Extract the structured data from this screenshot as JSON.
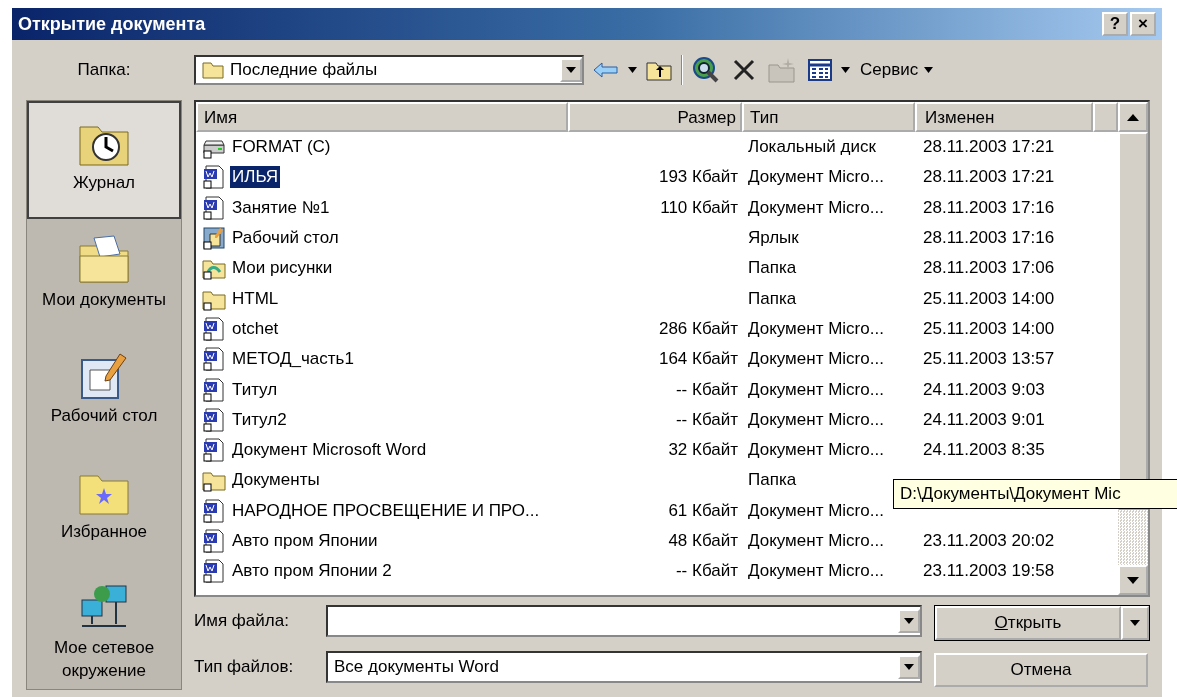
{
  "window": {
    "title": "Открытие документа",
    "buttons": [
      "?",
      "×"
    ]
  },
  "toolbar": {
    "folder_label": "Папка:",
    "folder_value": "Последние файлы",
    "menu": "Сервис"
  },
  "places": [
    {
      "label": "Журнал",
      "kind": "history",
      "selected": true
    },
    {
      "label": "Мои документы",
      "kind": "documents",
      "selected": false
    },
    {
      "label": "Рабочий стол",
      "kind": "desktop",
      "selected": false
    },
    {
      "label": "Избранное",
      "kind": "favorites",
      "selected": false
    },
    {
      "label": "Мое сетевое окружение",
      "kind": "network",
      "selected": false
    }
  ],
  "table": {
    "columns": [
      "Имя",
      "Размер",
      "Тип",
      "Изменен"
    ],
    "rows": [
      {
        "name": "FORMAT (C)",
        "size": "",
        "type": "Локальный диск",
        "modified": "28.11.2003 17:21",
        "kind": "drive",
        "selected": false
      },
      {
        "name": "ИЛЬЯ",
        "size": "193 Кбайт",
        "type": "Документ Micro...",
        "modified": "28.11.2003 17:21",
        "kind": "doc",
        "selected": true
      },
      {
        "name": "Занятие №1",
        "size": "110 Кбайт",
        "type": "Документ Micro...",
        "modified": "28.11.2003 17:16",
        "kind": "doc",
        "selected": false
      },
      {
        "name": "Рабочий стол",
        "size": "",
        "type": "Ярлык",
        "modified": "28.11.2003 17:16",
        "kind": "desktop",
        "selected": false
      },
      {
        "name": "Мои рисунки",
        "size": "",
        "type": "Папка",
        "modified": "28.11.2003 17:06",
        "kind": "pictures",
        "selected": false
      },
      {
        "name": "HTML",
        "size": "",
        "type": "Папка",
        "modified": "25.11.2003 14:00",
        "kind": "folder",
        "selected": false
      },
      {
        "name": "otchet",
        "size": "286 Кбайт",
        "type": "Документ Micro...",
        "modified": "25.11.2003 14:00",
        "kind": "doc",
        "selected": false
      },
      {
        "name": "МЕТОД_часть1",
        "size": "164 Кбайт",
        "type": "Документ Micro...",
        "modified": "25.11.2003 13:57",
        "kind": "doc",
        "selected": false
      },
      {
        "name": "Титул",
        "size": "-- Кбайт",
        "type": "Документ Micro...",
        "modified": "24.11.2003 9:03",
        "kind": "doc",
        "selected": false
      },
      {
        "name": "Титул2",
        "size": "-- Кбайт",
        "type": "Документ Micro...",
        "modified": "24.11.2003 9:01",
        "kind": "doc",
        "selected": false
      },
      {
        "name": "Документ Microsoft Word",
        "size": "32 Кбайт",
        "type": "Документ Micro...",
        "modified": "24.11.2003 8:35",
        "kind": "doc",
        "selected": false
      },
      {
        "name": "Документы",
        "size": "",
        "type": "Папка",
        "kind": "folder",
        "selected": false
      },
      {
        "name": "НАРОДНОЕ ПРОСВЕЩЕНИЕ И ПРО...",
        "size": "61 Кбайт",
        "type": "Документ Micro...",
        "kind": "doc",
        "selected": false
      },
      {
        "name": "Авто пром Японии",
        "size": "48 Кбайт",
        "type": "Документ Micro...",
        "modified": "23.11.2003 20:02",
        "kind": "doc",
        "selected": false
      },
      {
        "name": "Авто пром Японии 2",
        "size": "-- Кбайт",
        "type": "Документ Micro...",
        "modified": "23.11.2003 19:58",
        "kind": "doc",
        "selected": false
      }
    ]
  },
  "tooltip": "D:\\Документы\\Документ Mic",
  "file_name": {
    "label": "Имя файла:"
  },
  "file_type": {
    "label": "Тип файлов:",
    "value": "Все документы Word"
  },
  "buttons": {
    "open": "Открыть",
    "cancel": "Отмена"
  }
}
